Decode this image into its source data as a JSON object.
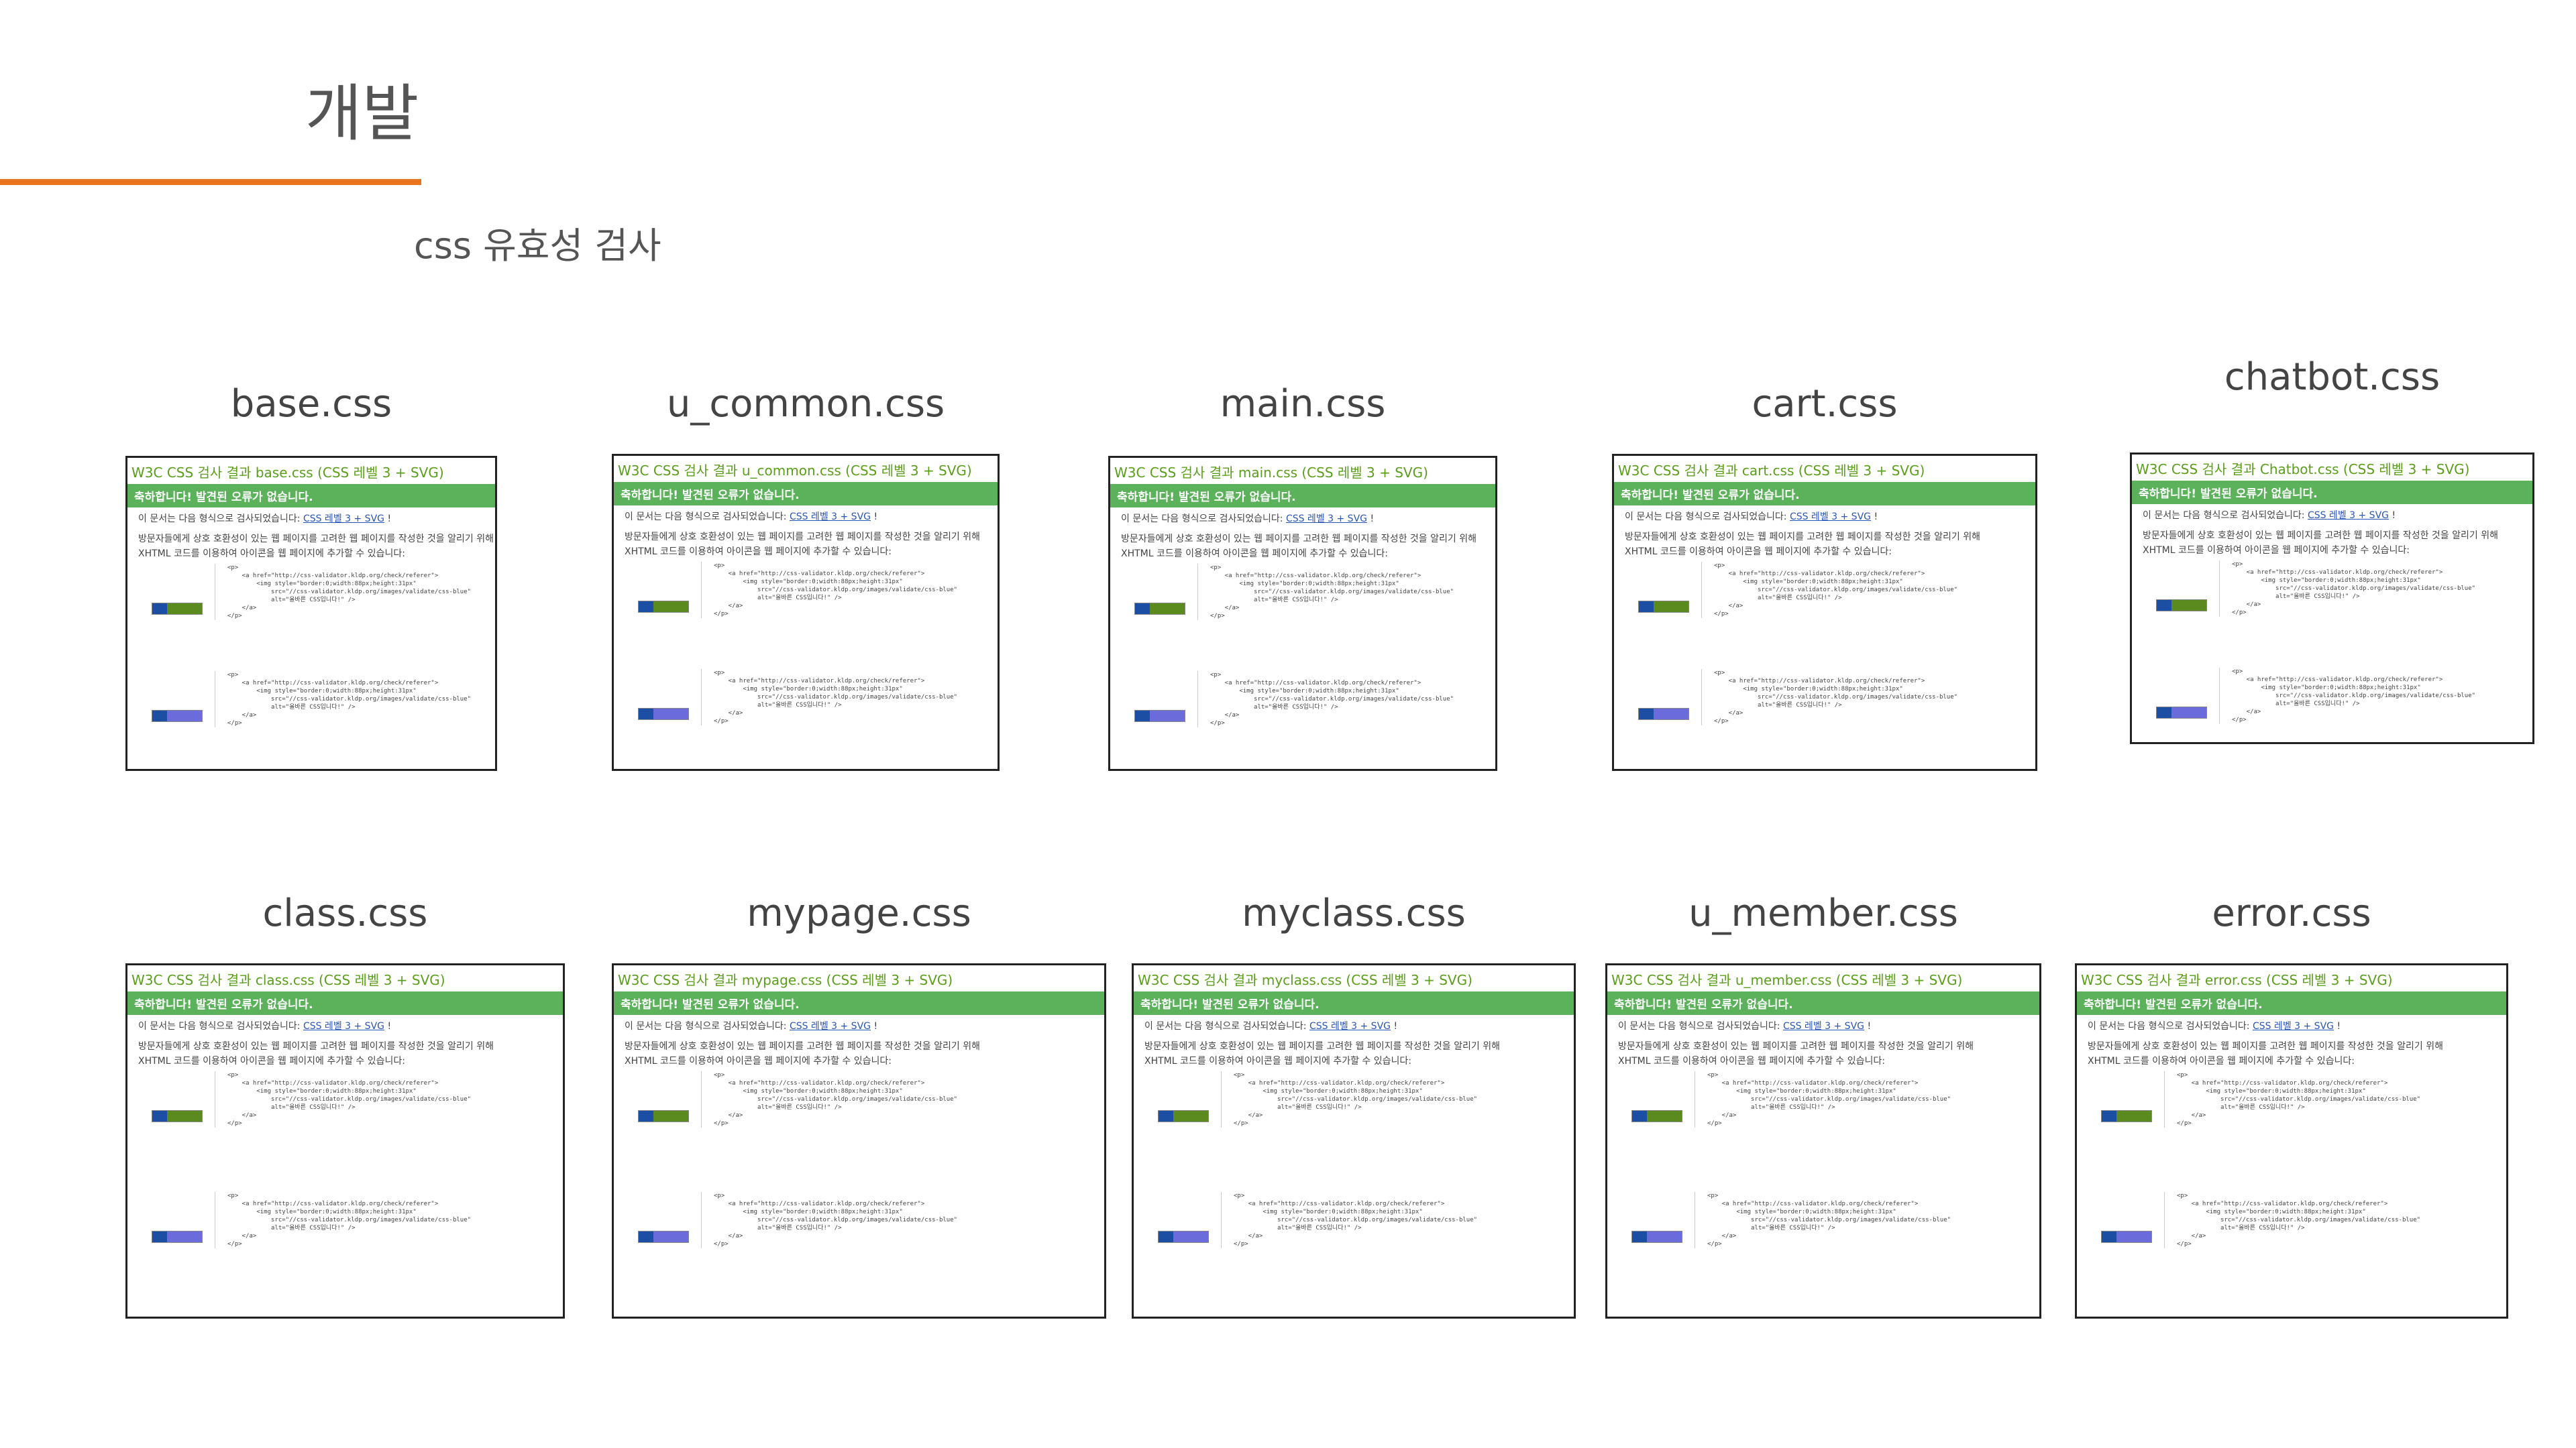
{
  "page": {
    "title": "개발",
    "subtitle": "css 유효성 검사",
    "accent_color": "#e9741d"
  },
  "validator": {
    "valid_banner": "축하합니다! 발견된 오류가 없습니다.",
    "doc_info": "이 문서는 다음 형식으로 검사되었습니다: ",
    "doc_link": "CSS 레벨 3 + SVG",
    "doc_suffix": " !",
    "para_line1": "방문자들에게 상호 호환성이 있는 웹 페이지를 고려한 웹 페이지를 작성한 것을 알리기 위해",
    "para_line2": "XHTML 코드를 이용하여 아이콘을 웹 페이지에 추가할 수 있습니다:",
    "code_snippet": "<p>\n    <a href=\"http://css-validator.kldp.org/check/referer\">\n        <img style=\"border:0;width:88px;height:31px\"\n            src=\"//css-validator.kldp.org/images/validate/css-blue\"\n            alt=\"올바른 CSS입니다!\" />\n    </a>\n</p>"
  },
  "cards": [
    {
      "label": "base.css",
      "heading": "W3C CSS 검사 결과 base.css (CSS 레벨 3 + SVG)"
    },
    {
      "label": "u_common.css",
      "heading": "W3C CSS 검사 결과 u_common.css (CSS 레벨 3 + SVG)"
    },
    {
      "label": "main.css",
      "heading": "W3C CSS 검사 결과 main.css (CSS 레벨 3 + SVG)"
    },
    {
      "label": "cart.css",
      "heading": "W3C CSS 검사 결과 cart.css (CSS 레벨 3 + SVG)"
    },
    {
      "label": "chatbot.css",
      "heading": "W3C CSS 검사 결과 Chatbot.css (CSS 레벨 3 + SVG)"
    },
    {
      "label": "class.css",
      "heading": "W3C CSS 검사 결과 class.css (CSS 레벨 3 + SVG)"
    },
    {
      "label": "mypage.css",
      "heading": "W3C CSS 검사 결과 mypage.css (CSS 레벨 3 + SVG)"
    },
    {
      "label": "myclass.css",
      "heading": "W3C CSS 검사 결과 myclass.css (CSS 레벨 3 + SVG)"
    },
    {
      "label": "u_member.css",
      "heading": "W3C CSS 검사 결과 u_member.css (CSS 레벨 3 + SVG)"
    },
    {
      "label": "error.css",
      "heading": "W3C CSS 검사 결과 error.css (CSS 레벨 3 + SVG)"
    }
  ]
}
